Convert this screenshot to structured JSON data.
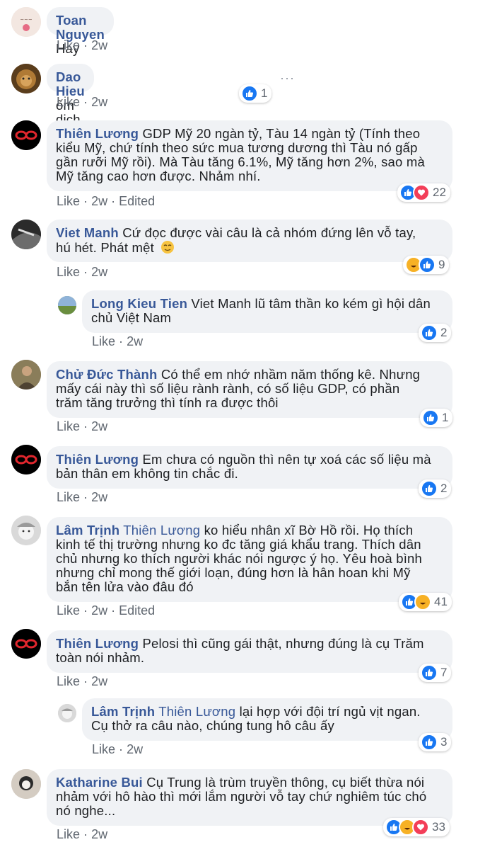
{
  "ui": {
    "like": "Like",
    "edited": "Edited",
    "sep": "·",
    "more": "···"
  },
  "comments": [
    {
      "author": "Toan Nguyen",
      "text": "Hay",
      "time": "2w"
    },
    {
      "author": "Dao Hieu",
      "text": "ốm dịch thì ai chả giảm",
      "time": "2w",
      "reaction_count": "1"
    },
    {
      "author": "Thiên Lương",
      "line1": "GDP Mỹ 20 ngàn tỷ, Tàu 14 ngàn tỷ (Tính theo",
      "line2": "kiểu Mỹ, chứ tính theo sức mua tương dương thì Tàu nó gấp",
      "line3": "gần rưỡi Mỹ rồi). Mà Tàu tăng 6.1%, Mỹ tăng hơn 2%, sao mà",
      "line4": "Mỹ tăng cao hơn được. Nhảm nhí.",
      "time": "2w",
      "reaction_count": "22"
    },
    {
      "author": "Viet Manh",
      "line1": "Cứ đọc được vài câu là cả nhóm đứng lên vỗ tay,",
      "line2": "hú hét. Phát mệt",
      "time": "2w",
      "reaction_count": "9"
    },
    {
      "author": "Long Kieu Tien",
      "line1": "Viet Manh lũ tâm thần ko kém gì hội dân",
      "line2": "chủ Việt Nam",
      "time": "2w",
      "reaction_count": "2"
    },
    {
      "author": "Chử Đức Thành",
      "line1": "Có thể em nhớ nhầm năm thống kê. Nhưng",
      "line2": "mấy cái này thì số liệu rành rành, có số liệu GDP, có phần",
      "line3": "trăm tăng trưởng thì tính ra được thôi",
      "time": "2w",
      "reaction_count": "1"
    },
    {
      "author": "Thiên Lương",
      "line1": "Em chưa có nguồn thì nên tự xoá các số liệu mà",
      "line2": "bản thân em không tin chắc đi.",
      "time": "2w",
      "reaction_count": "2"
    },
    {
      "author": "Lâm Trịnh",
      "tag": "Thiên Lương",
      "line1": "ko hiểu nhân xĩ Bờ Hồ rồi. Họ thích",
      "line2": "kinh tế thị trường nhưng ko đc tăng giá khẩu trang. Thích dân",
      "line3": "chủ nhưng ko thích người khác nói ngược ý họ. Yêu hoà bình",
      "line4": "nhưng chỉ mong thế giới loạn, đúng hơn là hân hoan khi Mỹ",
      "line5": "bắn tên lửa vào đâu đó",
      "time": "2w",
      "reaction_count": "41"
    },
    {
      "author": "Thiên Lương",
      "line1": "Pelosi thì cũng gái thật, nhưng đúng là cụ Trăm",
      "line2": "toàn nói nhảm.",
      "time": "2w",
      "reaction_count": "7"
    },
    {
      "author": "Lâm Trịnh",
      "tag": "Thiên Lương",
      "line1": "lại hợp với đội trí ngủ vịt ngan.",
      "line2": "Cụ thở ra câu nào, chúng tung hô câu ấy",
      "time": "2w",
      "reaction_count": "3"
    },
    {
      "author": "Katharine Bui",
      "line1": "Cụ Trung là trùm truyền thông, cụ biết thừa nói",
      "line2": "nhảm với hô hào thì mới lắm người vỗ tay chứ nghiêm túc chó",
      "line3": "nó nghe...",
      "time": "2w",
      "reaction_count": "33"
    }
  ],
  "colors": {
    "name": "#385898",
    "bubble": "#f0f2f5",
    "meta": "#606770",
    "like": "#1877f2",
    "haha": "#f7b125",
    "love": "#f33e58"
  }
}
